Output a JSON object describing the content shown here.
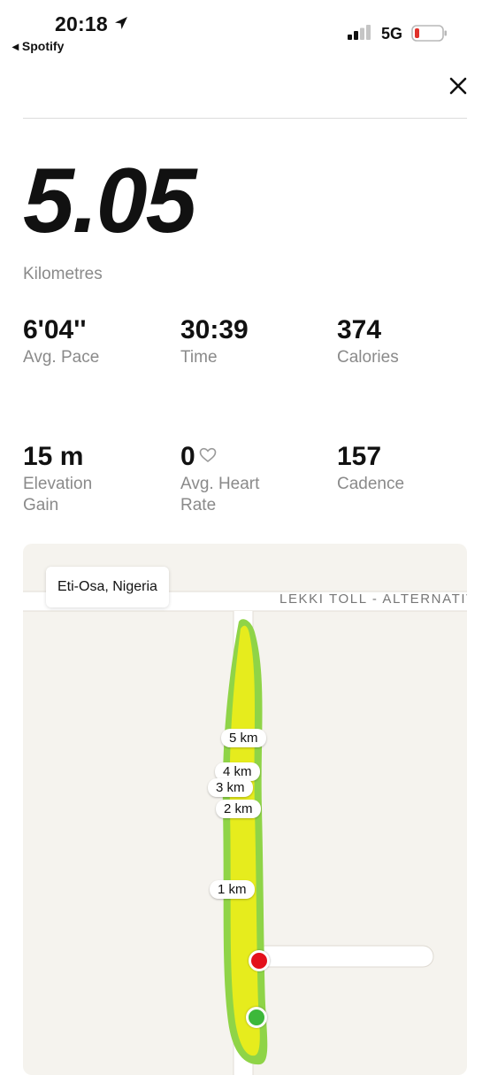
{
  "status_bar": {
    "time": "20:18",
    "back_app": "◂ Spotify",
    "network": "5G",
    "battery_color": "#e0322b"
  },
  "summary": {
    "distance": "5.05",
    "distance_unit": "Kilometres"
  },
  "stats": [
    {
      "value": "6'04''",
      "label": "Avg. Pace"
    },
    {
      "value": "30:39",
      "label": "Time"
    },
    {
      "value": "374",
      "label": "Calories"
    },
    {
      "value": "15 m",
      "label": "Elevation Gain"
    },
    {
      "value": "0",
      "label": "Avg. Heart Rate",
      "icon": "heart-outline-icon"
    },
    {
      "value": "157",
      "label": "Cadence"
    }
  ],
  "map": {
    "location": "Eti-Osa, Nigeria",
    "street_label": "LEKKI TOLL - ALTERNATIVE",
    "km_markers": [
      "5 km",
      "4 km",
      "3 km",
      "2 km",
      "1 km"
    ],
    "route_colors": {
      "fast": "#e6ec1d",
      "slow": "#8fd447"
    },
    "start_color": "#3db83a",
    "end_color": "#e3111b"
  },
  "icons": {
    "close": "close-icon",
    "location": "location-arrow-icon",
    "signal": "signal-bars-icon",
    "battery": "battery-icon"
  }
}
